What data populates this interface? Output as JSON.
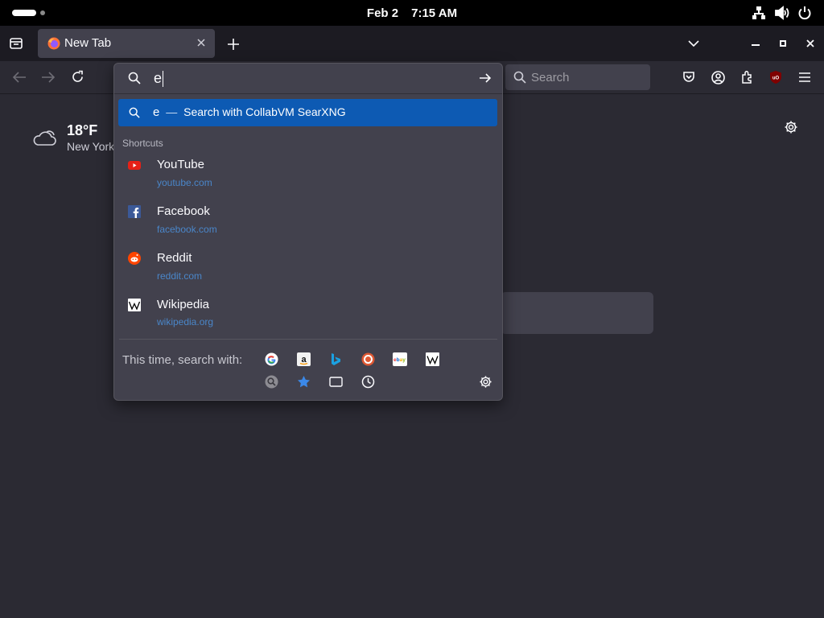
{
  "topbar": {
    "date": "Feb 2",
    "time": "7:15 AM"
  },
  "tab": {
    "title": "New Tab"
  },
  "urlbar": {
    "value": "e",
    "suggestion": {
      "query": "e",
      "separator": "—",
      "action": "Search with CollabVM SearXNG"
    },
    "shortcuts_label": "Shortcuts",
    "shortcuts": [
      {
        "title": "YouTube",
        "url": "youtube.com",
        "icon": "youtube-icon"
      },
      {
        "title": "Facebook",
        "url": "facebook.com",
        "icon": "facebook-icon"
      },
      {
        "title": "Reddit",
        "url": "reddit.com",
        "icon": "reddit-icon"
      },
      {
        "title": "Wikipedia",
        "url": "wikipedia.org",
        "icon": "wikipedia-icon"
      }
    ],
    "footer_label": "This time, search with:",
    "engines": [
      "google-icon",
      "amazon-icon",
      "bing-icon",
      "duckduckgo-icon",
      "ebay-icon",
      "wikipedia-icon"
    ],
    "modes": [
      "searxng-icon",
      "bookmarks-icon",
      "tabs-icon",
      "history-icon"
    ]
  },
  "nav": {
    "search_placeholder": "Search"
  },
  "weather": {
    "temp": "18°F",
    "city": "New York"
  },
  "colors": {
    "accent": "#0d5ab3",
    "background": "#2b2a33",
    "panel": "#42414d",
    "link": "#4a86c9"
  }
}
